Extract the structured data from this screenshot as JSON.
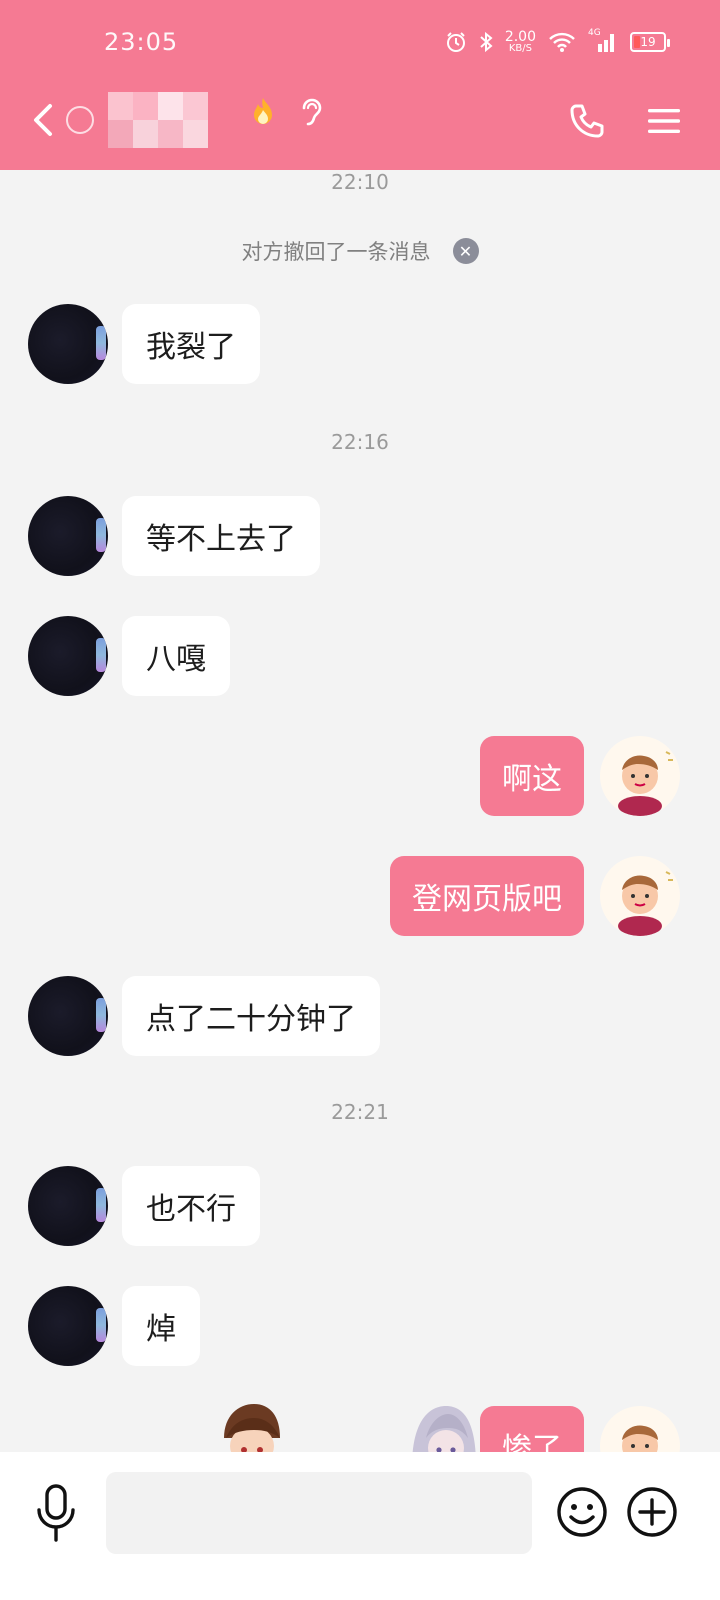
{
  "status_bar": {
    "time": "23:05",
    "net_speed_value": "2.00",
    "net_speed_unit": "KB/S",
    "signal_label": "4G",
    "battery_level": "19"
  },
  "header": {
    "contact_name_obscured": true,
    "back_icon": "chevron-left-icon",
    "call_icon": "phone-icon",
    "menu_icon": "hamburger-menu-icon"
  },
  "chat": {
    "messages": [
      {
        "type": "timestamp",
        "text": "22:10"
      },
      {
        "type": "system",
        "text": "对方撤回了一条消息"
      },
      {
        "type": "in",
        "text": "我裂了"
      },
      {
        "type": "timestamp",
        "text": "22:16"
      },
      {
        "type": "in",
        "text": "等不上去了"
      },
      {
        "type": "in",
        "text": "八嘎"
      },
      {
        "type": "out",
        "text": "啊这"
      },
      {
        "type": "out",
        "text": "登网页版吧"
      },
      {
        "type": "in",
        "text": "点了二十分钟了"
      },
      {
        "type": "timestamp",
        "text": "22:21"
      },
      {
        "type": "in",
        "text": "也不行"
      },
      {
        "type": "in",
        "text": "焯"
      },
      {
        "type": "out",
        "text": "惨了"
      }
    ]
  },
  "input_bar": {
    "placeholder": "",
    "voice_icon": "microphone-icon",
    "emoji_icon": "smiley-icon",
    "more_icon": "plus-circle-icon"
  },
  "colors": {
    "accent": "#f57a93",
    "background": "#f3f3f3",
    "bubble_in": "#ffffff"
  }
}
